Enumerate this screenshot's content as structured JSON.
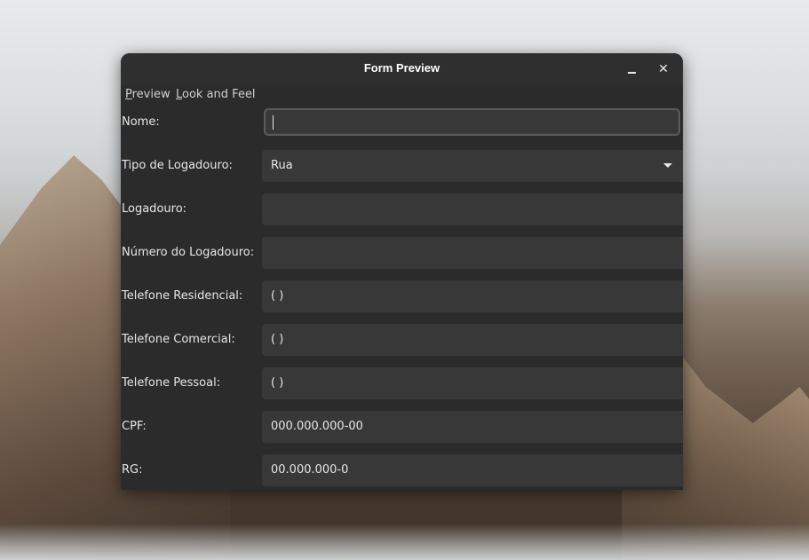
{
  "window": {
    "title": "Form Preview",
    "minimize_icon": "minimize-icon",
    "close_icon": "close-icon",
    "close_glyph": "✕"
  },
  "menu": {
    "items": [
      {
        "mnemonic": "P",
        "rest": "review"
      },
      {
        "mnemonic": "L",
        "rest": "ook and Feel"
      }
    ]
  },
  "form": {
    "rows": [
      {
        "label": "Nome:",
        "value": "",
        "kind": "text-input",
        "focused": true
      },
      {
        "label": "Tipo de Logadouro:",
        "value": "Rua",
        "kind": "dropdown"
      },
      {
        "label": "Logadouro:",
        "value": "",
        "kind": "text-input"
      },
      {
        "label": "Número do Logadouro:",
        "value": "",
        "kind": "text-input"
      },
      {
        "label": "Telefone Residencial:",
        "value": "( )",
        "kind": "formatted-input"
      },
      {
        "label": "Telefone Comercial:",
        "value": "( )",
        "kind": "formatted-input"
      },
      {
        "label": "Telefone Pessoal:",
        "value": "( )",
        "kind": "formatted-input"
      },
      {
        "label": "CPF:",
        "value": "000.000.000-00",
        "kind": "formatted-input"
      },
      {
        "label": "RG:",
        "value": "00.000.000-0",
        "kind": "formatted-input"
      }
    ]
  },
  "colors": {
    "window_bg": "#2b2b2b",
    "field_bg": "#383838",
    "text": "#e6e6e6"
  }
}
